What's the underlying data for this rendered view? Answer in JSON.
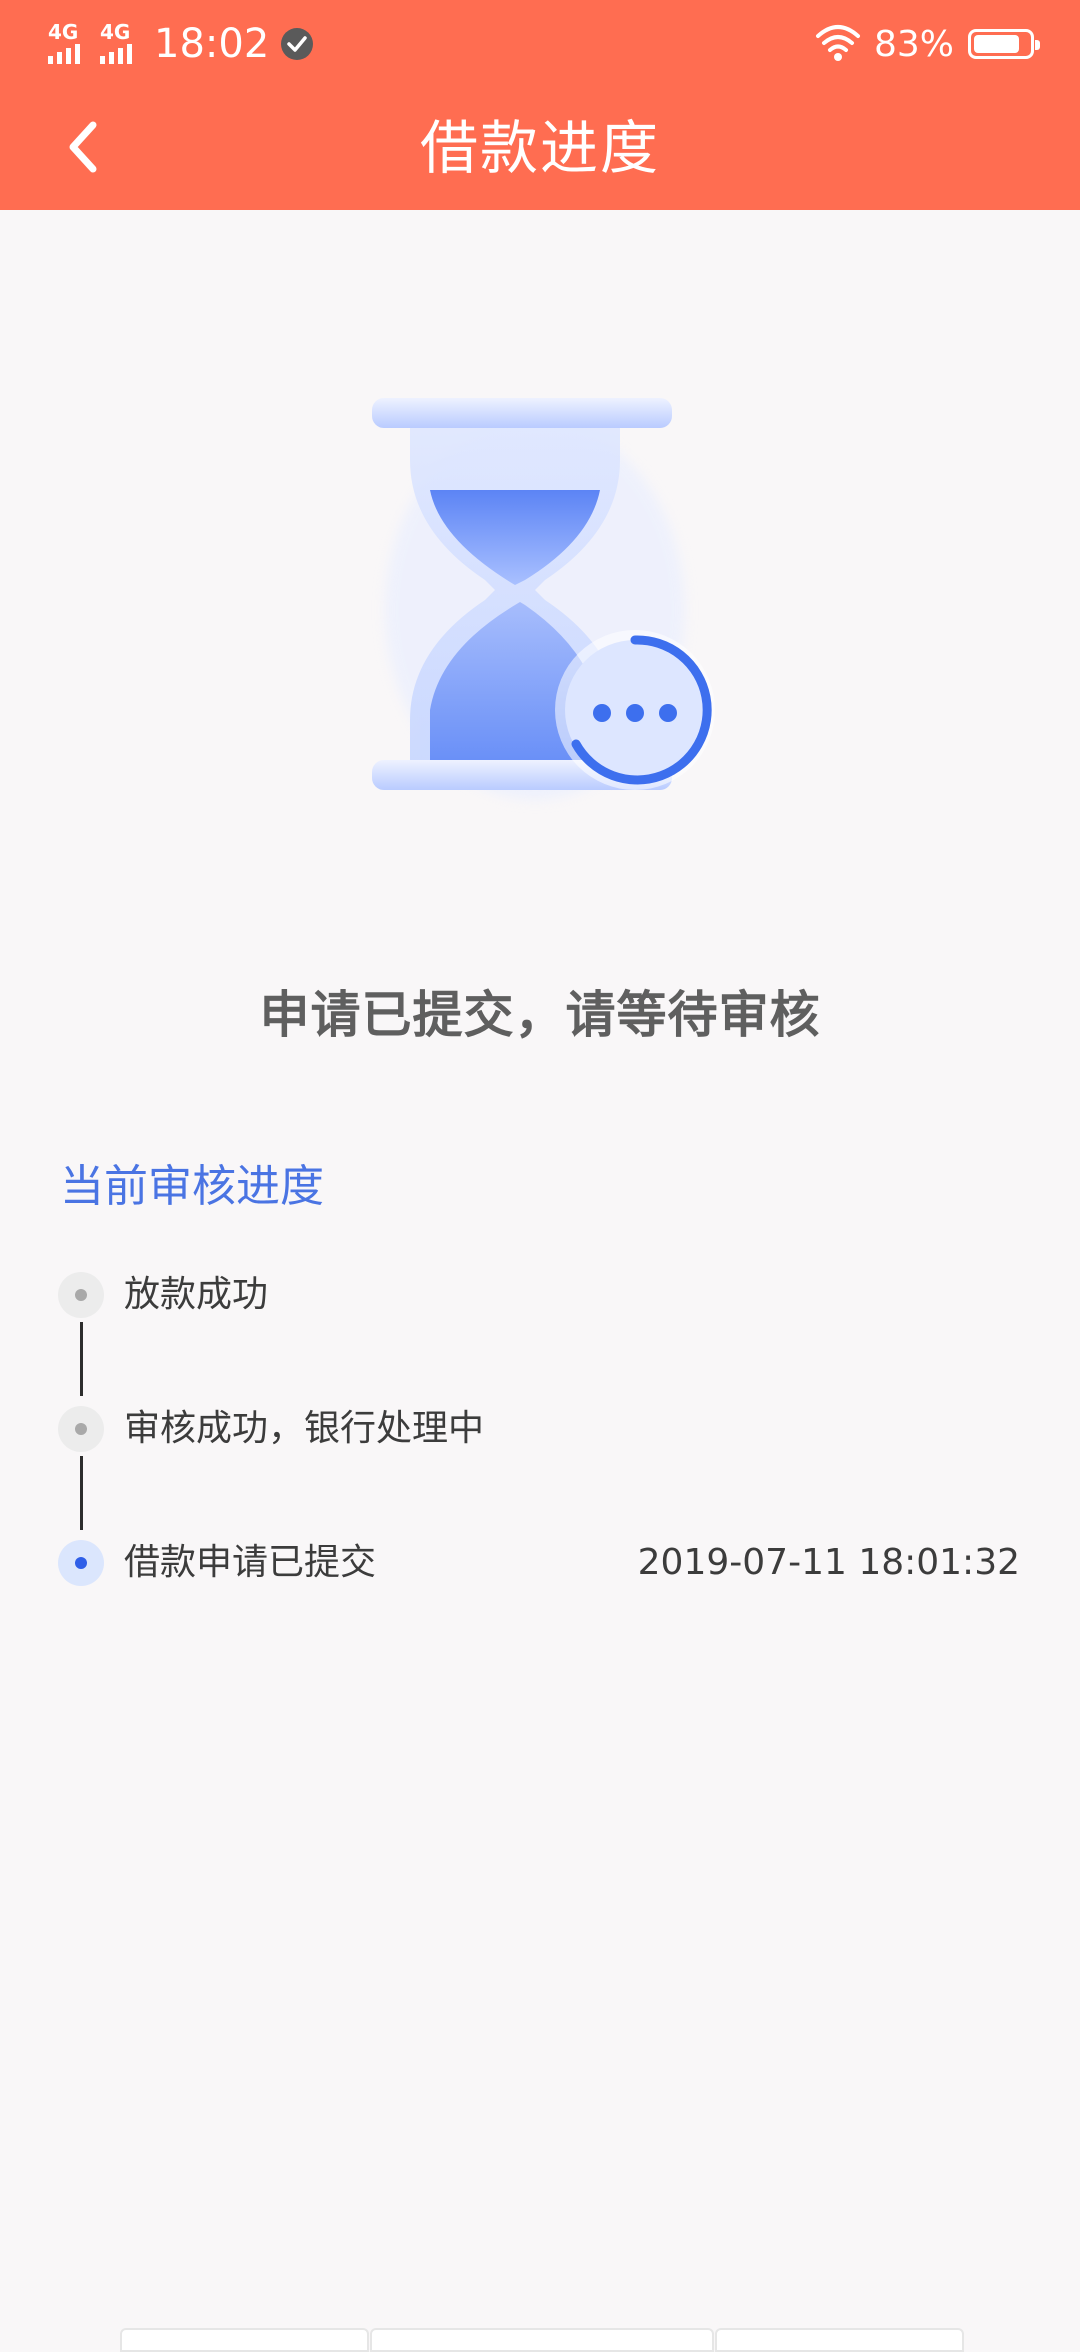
{
  "status_bar": {
    "network_1": "4G",
    "network_2": "4G",
    "time": "18:02",
    "battery_percent": "83%",
    "battery_level": 0.83
  },
  "nav": {
    "title": "借款进度",
    "back_icon": "chevron-left-icon"
  },
  "illustration": {
    "icon": "hourglass-waiting-icon",
    "colors": {
      "glass_light": "#c9d8ff",
      "sand": "#4f7bf3",
      "badge_ring": "#3d6fee"
    }
  },
  "message": "申请已提交，请等待审核",
  "progress": {
    "section_title": "当前审核进度",
    "steps": [
      {
        "label": "放款成功",
        "time": "",
        "active": false
      },
      {
        "label": "审核成功，银行处理中",
        "time": "",
        "active": false
      },
      {
        "label": "借款申请已提交",
        "time": "2019-07-11 18:01:32",
        "active": true
      }
    ]
  },
  "colors": {
    "header": "#ff6d51",
    "accent_blue": "#4a74e3",
    "background": "#f9f7f8"
  }
}
